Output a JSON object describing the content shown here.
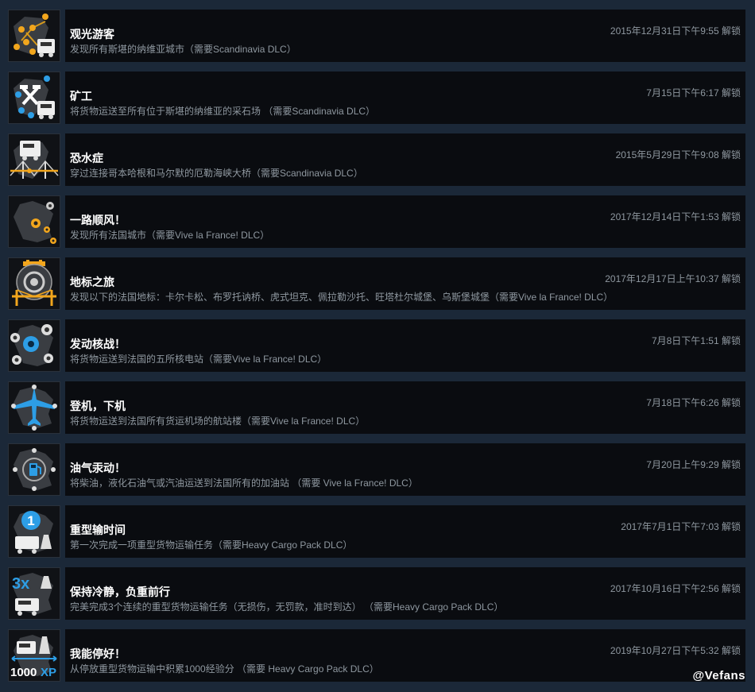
{
  "achievements": [
    {
      "icon": "sightseer-map-truck-icon",
      "title": "观光游客",
      "desc": "发现所有斯堪的纳维亚城市（需要Scandinavia DLC）",
      "date": "2015年12月31日下午9:55 解锁"
    },
    {
      "icon": "miner-pickaxe-truck-icon",
      "title": "矿工",
      "desc": "将货物运送至所有位于斯堪的纳维亚的采石场 （需要Scandinavia DLC）",
      "date": "7月15日下午6:17 解锁"
    },
    {
      "icon": "bridge-truck-icon",
      "title": "恐水症",
      "desc": "穿过连接哥本哈根和马尔默的厄勒海峡大桥（需要Scandinavia DLC）",
      "date": "2015年5月29日下午9:08 解锁"
    },
    {
      "icon": "france-map-cities-icon",
      "title": "一路顺风！",
      "desc": "发现所有法国城市（需要Vive la France! DLC）",
      "date": "2017年12月14日下午1:53 解锁"
    },
    {
      "icon": "landmark-bridge-icon",
      "title": "地标之旅",
      "desc": "发现以下的法国地标：卡尔卡松、布罗托讷桥、虎式坦克、佩拉勒沙托、旺塔杜尔城堡、乌斯堡城堡（需要Vive la France! DLC）",
      "date": "2017年12月17日上午10:37 解锁"
    },
    {
      "icon": "nuclear-map-icon",
      "title": "发动核战！",
      "desc": "将货物运送到法国的五所核电站（需要Vive la France! DLC）",
      "date": "7月8日下午1:51 解锁"
    },
    {
      "icon": "airplane-map-icon",
      "title": "登机，下机",
      "desc": "将货物运送到法国所有货运机场的航站楼（需要Vive la France! DLC）",
      "date": "7月18日下午6:26 解锁"
    },
    {
      "icon": "fuel-pump-map-icon",
      "title": "油气汞动！",
      "desc": "将柴油，液化石油气或汽油运送到法国所有的加油站 （需要 Vive la France! DLC）",
      "date": "7月20日上午9:29 解锁"
    },
    {
      "icon": "heavy-cargo-first-icon",
      "title": "重型输时间",
      "desc": "第一次完成一项重型货物运输任务（需要Heavy Cargo Pack DLC）",
      "date": "2017年7月1日下午7:03 解锁"
    },
    {
      "icon": "heavy-cargo-3x-icon",
      "title": "保持冷静，负重前行",
      "desc": "完美完成3个连续的重型货物运输任务（无损伤，无罚款，准时到达） （需要Heavy Cargo Pack DLC）",
      "date": "2017年10月16日下午2:56 解锁"
    },
    {
      "icon": "heavy-cargo-1000xp-icon",
      "title": "我能停好！",
      "desc": "从停放重型货物运输中积累1000经验分 （需要 Heavy Cargo Pack DLC）",
      "date": "2019年10月27日下午5:32 解锁"
    }
  ],
  "icon_text": {
    "one": "1",
    "three_x": "3x",
    "xp_number": "1000",
    "xp_suffix": "XP"
  },
  "colors": {
    "background": "#1b2838",
    "row": "#0a0c10",
    "title": "#ffffff",
    "muted": "#8f98a0",
    "accent_orange": "#f2a61d",
    "accent_blue": "#2d9ee6"
  },
  "watermark": "@Vefans"
}
